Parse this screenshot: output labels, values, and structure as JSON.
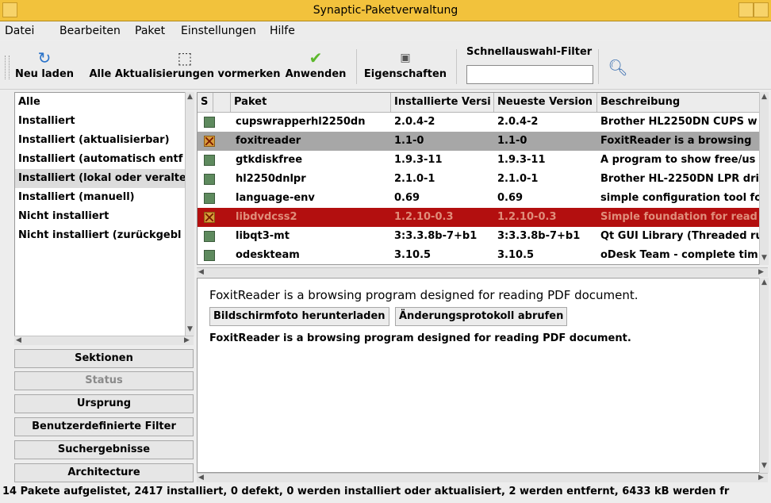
{
  "window": {
    "title": "Synaptic-Paketverwaltung"
  },
  "menu": [
    "Datei",
    "Bearbeiten",
    "Paket",
    "Einstellungen",
    "Hilfe"
  ],
  "toolbar": {
    "reload": "Neu laden",
    "mark_all_upgrades": "Alle Aktualisierungen vormerken",
    "apply": "Anwenden",
    "properties": "Eigenschaften",
    "quick_filter_label": "Schnellauswahl-Filter",
    "quick_filter_value": ""
  },
  "filters": [
    {
      "label": "Alle"
    },
    {
      "label": "Installiert"
    },
    {
      "label": "Installiert (aktualisierbar)"
    },
    {
      "label": "Installiert (automatisch entf"
    },
    {
      "label": "Installiert (lokal oder veralte"
    },
    {
      "label": "Installiert (manuell)"
    },
    {
      "label": "Nicht installiert"
    },
    {
      "label": "Nicht installiert (zurückgebl"
    }
  ],
  "selected_filter": "Installiert (lokal oder veralte",
  "side_buttons": [
    "Sektionen",
    "Status",
    "Ursprung",
    "Benutzerdefinierte Filter",
    "Suchergebnisse",
    "Architecture"
  ],
  "columns": [
    "S",
    "Paket",
    "Installierte Versi",
    "Neueste Version",
    "Beschreibung"
  ],
  "packages": [
    {
      "name": "cupswrapperhl2250dn",
      "installed": "2.0.4-2",
      "latest": "2.0.4-2",
      "description": "Brother HL2250DN CUPS w",
      "state": "installed"
    },
    {
      "name": "foxitreader",
      "installed": "1.1-0",
      "latest": "1.1-0",
      "description": "FoxitReader is a browsing",
      "state": "remove"
    },
    {
      "name": "gtkdiskfree",
      "installed": "1.9.3-11",
      "latest": "1.9.3-11",
      "description": "A program to show free/us",
      "state": "installed"
    },
    {
      "name": "hl2250dnlpr",
      "installed": "2.1.0-1",
      "latest": "2.1.0-1",
      "description": "Brother HL-2250DN LPR dri",
      "state": "installed"
    },
    {
      "name": "language-env",
      "installed": "0.69",
      "latest": "0.69",
      "description": "simple configuration tool fo",
      "state": "installed"
    },
    {
      "name": "libdvdcss2",
      "installed": "1.2.10-0.3",
      "latest": "1.2.10-0.3",
      "description": "Simple foundation for read",
      "state": "remove"
    },
    {
      "name": "libqt3-mt",
      "installed": "3:3.3.8b-7+b1",
      "latest": "3:3.3.8b-7+b1",
      "description": "Qt GUI Library (Threaded ru",
      "state": "installed"
    },
    {
      "name": "odeskteam",
      "installed": "3.10.5",
      "latest": "3.10.5",
      "description": "oDesk Team -  complete tim",
      "state": "installed"
    }
  ],
  "details": {
    "headline": "FoxitReader is a browsing program designed for reading PDF document.",
    "screenshot_button": "Bildschirmfoto herunterladen",
    "changelog_button": "Änderungsprotokoll abrufen",
    "body": "FoxitReader is a browsing program designed for reading PDF document."
  },
  "status": "14 Pakete aufgelistet, 2417 installiert, 0 defekt, 0 werden installiert oder aktualisiert, 2 werden entfernt, 6433 kB werden fr"
}
